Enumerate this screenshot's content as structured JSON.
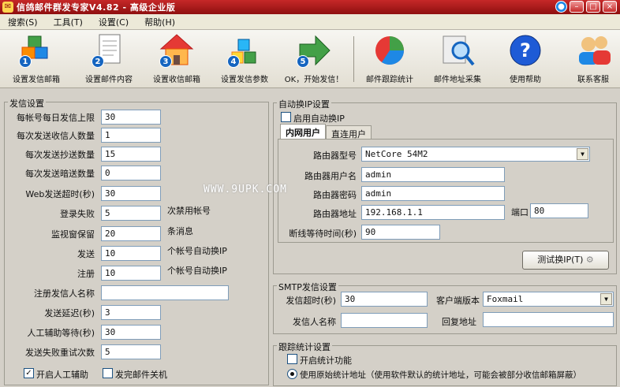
{
  "window": {
    "title": "信鸽邮件群发专家V4.82 - 高级企业版"
  },
  "menu": [
    "搜索(S)",
    "工具(T)",
    "设置(C)",
    "帮助(H)"
  ],
  "toolbar": [
    {
      "num": "1",
      "label": "设置发信邮箱",
      "icon": "cubes-icon"
    },
    {
      "num": "2",
      "label": "设置邮件内容",
      "icon": "document-icon"
    },
    {
      "num": "3",
      "label": "设置收信邮箱",
      "icon": "house-icon"
    },
    {
      "num": "4",
      "label": "设置发信参数",
      "icon": "blocks-icon"
    },
    {
      "num": "5",
      "label": "OK，开始发信！",
      "icon": "arrow-right-icon"
    },
    {
      "num": "",
      "label": "邮件跟踪统计",
      "icon": "pie-chart-icon"
    },
    {
      "num": "",
      "label": "邮件地址采集",
      "icon": "magnifier-icon"
    },
    {
      "num": "",
      "label": "使用帮助",
      "icon": "help-icon"
    },
    {
      "num": "",
      "label": "联系客服",
      "icon": "support-icon"
    }
  ],
  "send_settings": {
    "legend": "发信设置",
    "rows": [
      {
        "label": "每帐号每日发信上限",
        "value": "30"
      },
      {
        "label": "每次发送收信人数量",
        "value": "1"
      },
      {
        "label": "每次发送抄送数量",
        "value": "15"
      },
      {
        "label": "每次发送暗送数量",
        "value": "0"
      },
      {
        "label": "Web发送超时(秒)",
        "value": "30"
      },
      {
        "label": "登录失败",
        "value": "5",
        "suffix": "次禁用帐号"
      },
      {
        "label": "监视窗保留",
        "value": "20",
        "suffix": "条消息"
      },
      {
        "label": "发送",
        "value": "10",
        "suffix": "个帐号自动换IP"
      },
      {
        "label": "注册",
        "value": "10",
        "suffix": "个帐号自动换IP"
      },
      {
        "label": "注册发信人名称",
        "value": ""
      },
      {
        "label": "发送延迟(秒)",
        "value": "3"
      },
      {
        "label": "人工辅助等待(秒)",
        "value": "30"
      },
      {
        "label": "发送失败重试次数",
        "value": "5"
      }
    ],
    "manual_assist": {
      "label": "开启人工辅助",
      "checked": true
    },
    "shutdown_after": {
      "label": "发完邮件关机",
      "checked": false
    }
  },
  "auto_ip": {
    "legend": "自动换IP设置",
    "enable": {
      "label": "启用自动换IP",
      "checked": false
    },
    "tabs": [
      "内网用户",
      "直连用户"
    ],
    "router_model_label": "路由器型号",
    "router_model": "NetCore 54M2",
    "router_user_label": "路由器用户名",
    "router_user": "admin",
    "router_pass_label": "路由器密码",
    "router_pass": "admin",
    "router_addr_label": "路由器地址",
    "router_addr": "192.168.1.1",
    "port_label": "端口",
    "port": "80",
    "wait_label": "断线等待时间(秒)",
    "wait": "90",
    "test_button": "测试换IP(T)"
  },
  "smtp": {
    "legend": "SMTP发信设置",
    "timeout_label": "发信超时(秒)",
    "timeout": "30",
    "client_label": "客户端版本",
    "client": "Foxmail",
    "sender_label": "发信人名称",
    "sender": "",
    "reply_label": "回复地址",
    "reply": ""
  },
  "tracking": {
    "legend": "跟踪统计设置",
    "enable": {
      "label": "开启统计功能",
      "checked": false
    },
    "default_addr": "使用原始统计地址（使用软件默认的统计地址，可能会被部分收信邮箱屏蔽）"
  },
  "watermark": "WWW.9UPK.COM",
  "colors": {
    "title_bar": "#c62828",
    "panel_bg": "#d4d0c8"
  }
}
